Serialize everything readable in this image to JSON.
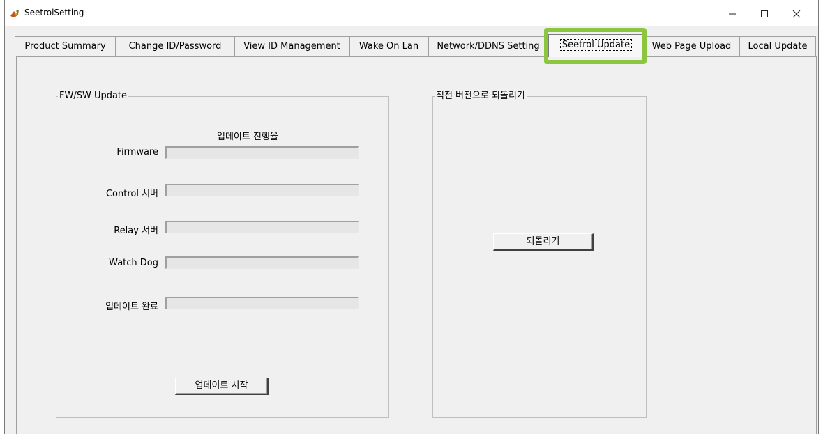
{
  "window": {
    "title": "SeetrolSetting",
    "icon": "seetrol-app-icon",
    "controls": {
      "minimize": "minimize-icon",
      "maximize": "maximize-icon",
      "close": "close-icon"
    }
  },
  "tabs": [
    {
      "label": "Product Summary",
      "active": false
    },
    {
      "label": "Change ID/Password",
      "active": false
    },
    {
      "label": "View ID Management",
      "active": false
    },
    {
      "label": "Wake On Lan",
      "active": false
    },
    {
      "label": "Network/DDNS Setting",
      "active": false
    },
    {
      "label": "Seetrol Update",
      "active": true
    },
    {
      "label": "Web Page Upload",
      "active": false
    },
    {
      "label": "Local Update",
      "active": false
    }
  ],
  "highlight_color": "#8cc63f",
  "fw_update": {
    "title": "FW/SW Update",
    "progress_header": "업데이트 진행율",
    "rows": [
      {
        "label": "Firmware",
        "progress": 0
      },
      {
        "label": "Control 서버",
        "progress": 0
      },
      {
        "label": "Relay 서버",
        "progress": 0
      },
      {
        "label": "Watch Dog",
        "progress": 0
      },
      {
        "label": "업데이트 완료",
        "progress": 0
      }
    ],
    "start_button": "업데이트 시작"
  },
  "rollback": {
    "title": "직전 버전으로 되돌리기",
    "button": "되돌리기"
  }
}
